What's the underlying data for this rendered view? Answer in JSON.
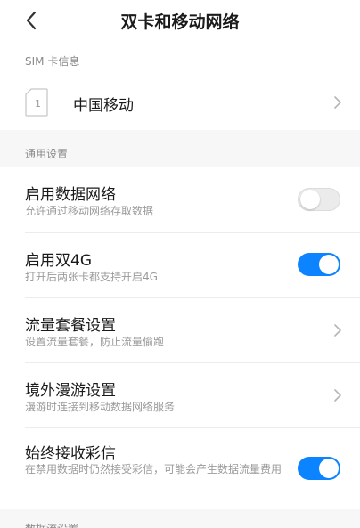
{
  "header": {
    "title": "双卡和移动网络"
  },
  "sim_section": {
    "label": "SIM 卡信息",
    "slot_number": "1",
    "carrier": "中国移动"
  },
  "general_section": {
    "label": "通用设置"
  },
  "settings": [
    {
      "title": "启用数据网络",
      "subtitle": "允许通过移动网络存取数据",
      "control": "toggle",
      "enabled": false
    },
    {
      "title": "启用双4G",
      "subtitle": "打开后两张卡都支持开启4G",
      "control": "toggle",
      "enabled": true
    },
    {
      "title": "流量套餐设置",
      "subtitle": "设置流量套餐，防止流量偷跑",
      "control": "chevron"
    },
    {
      "title": "境外漫游设置",
      "subtitle": "漫游时连接到移动数据网络服务",
      "control": "chevron"
    },
    {
      "title": "始终接收彩信",
      "subtitle": "在禁用数据时仍然接受彩信，可能会产生数据流量费用",
      "control": "toggle",
      "enabled": true
    }
  ],
  "next_section": {
    "label": "数据流设置"
  },
  "colors": {
    "accent": "#0d84ff",
    "toggle_off": "#ebebeb",
    "section_bg": "#f7f7f7"
  },
  "icons": {
    "back": "chevron-left-icon",
    "sim": "sim-card-icon",
    "row_arrow": "chevron-right-icon"
  }
}
